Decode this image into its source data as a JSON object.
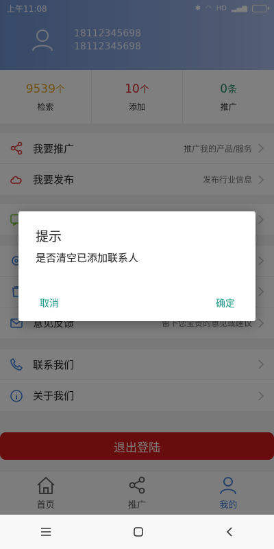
{
  "status_bar": {
    "time": "上午11:08",
    "signal_label": "HD"
  },
  "profile": {
    "phone_primary": "18112345698",
    "phone_secondary": "18112345698"
  },
  "stats": [
    {
      "value": "9539",
      "unit": "个",
      "label": "检索",
      "color": "#e0a020"
    },
    {
      "value": "10",
      "unit": "个",
      "label": "添加",
      "color": "#cc2222"
    },
    {
      "value": "0",
      "unit": "条",
      "label": "推广",
      "color": "#1f8a6a"
    }
  ],
  "menu_group1": [
    {
      "label": "我要推广",
      "hint": "推广我的产品/服务",
      "icon": "share-icon"
    },
    {
      "label": "我要发布",
      "hint": "发布行业信息",
      "icon": "cloud-icon"
    }
  ],
  "menu_group2": [
    {
      "label": "",
      "hint": "",
      "icon": "message-icon"
    }
  ],
  "menu_group3": [
    {
      "label": "",
      "hint": "",
      "icon": "settings-icon"
    },
    {
      "label": "",
      "hint": "",
      "icon": "trash-icon"
    },
    {
      "label": "意见反馈",
      "hint": "留下您宝贵的意见或建议",
      "icon": "feedback-icon"
    }
  ],
  "menu_group4": [
    {
      "label": "联系我们",
      "hint": "",
      "icon": "phone-icon"
    },
    {
      "label": "关于我们",
      "hint": "",
      "icon": "info-icon"
    }
  ],
  "logout_label": "退出登陆",
  "tabs": [
    {
      "label": "首页",
      "icon": "home-icon"
    },
    {
      "label": "推广",
      "icon": "share-icon"
    },
    {
      "label": "我的",
      "icon": "user-icon",
      "active": true
    }
  ],
  "dialog": {
    "title": "提示",
    "message": "是否清空已添加联系人",
    "cancel": "取消",
    "confirm": "确定"
  },
  "colors": {
    "accent": "#3c7dd8",
    "dialog_button": "#1c9a8a",
    "logout": "#d11a1a"
  }
}
